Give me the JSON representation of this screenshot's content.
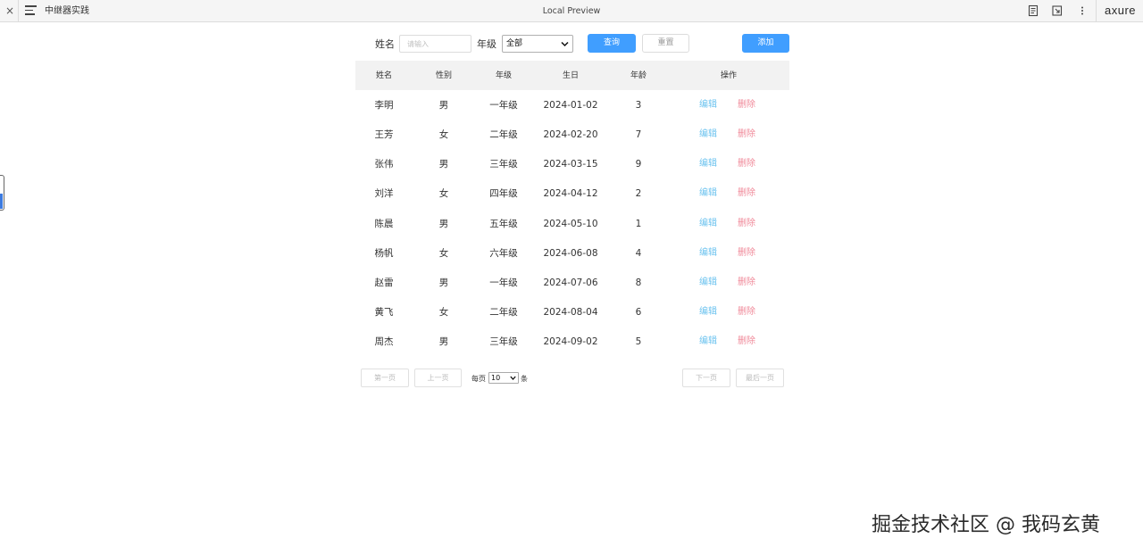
{
  "topbar": {
    "close_glyph": "×",
    "project_name": "中继器实践",
    "title": "Local Preview",
    "logo": "axure",
    "icons": [
      "close-icon",
      "menu-icon",
      "page-notes-icon",
      "open-external-icon",
      "more-vertical-icon"
    ]
  },
  "search": {
    "name_label": "姓名",
    "name_placeholder": "请输入",
    "grade_label": "年级",
    "grade_selected": "全部",
    "query_button": "查询",
    "reset_button": "重置",
    "add_button": "添加"
  },
  "table": {
    "headers": [
      "姓名",
      "性别",
      "年级",
      "生日",
      "年龄",
      "操作"
    ],
    "rows": [
      {
        "name": "李明",
        "gender": "男",
        "grade": "一年级",
        "birthday": "2024-01-02",
        "age": "3",
        "edit": "编辑",
        "delete": "删除"
      },
      {
        "name": "王芳",
        "gender": "女",
        "grade": "二年级",
        "birthday": "2024-02-20",
        "age": "7",
        "edit": "编辑",
        "delete": "删除"
      },
      {
        "name": "张伟",
        "gender": "男",
        "grade": "三年级",
        "birthday": "2024-03-15",
        "age": "9",
        "edit": "编辑",
        "delete": "删除"
      },
      {
        "name": "刘洋",
        "gender": "女",
        "grade": "四年级",
        "birthday": "2024-04-12",
        "age": "2",
        "edit": "编辑",
        "delete": "删除"
      },
      {
        "name": "陈晨",
        "gender": "男",
        "grade": "五年级",
        "birthday": "2024-05-10",
        "age": "1",
        "edit": "编辑",
        "delete": "删除"
      },
      {
        "name": "杨帆",
        "gender": "女",
        "grade": "六年级",
        "birthday": "2024-06-08",
        "age": "4",
        "edit": "编辑",
        "delete": "删除"
      },
      {
        "name": "赵雷",
        "gender": "男",
        "grade": "一年级",
        "birthday": "2024-07-06",
        "age": "8",
        "edit": "编辑",
        "delete": "删除"
      },
      {
        "name": "黄飞",
        "gender": "女",
        "grade": "二年级",
        "birthday": "2024-08-04",
        "age": "6",
        "edit": "编辑",
        "delete": "删除"
      },
      {
        "name": "周杰",
        "gender": "男",
        "grade": "三年级",
        "birthday": "2024-09-02",
        "age": "5",
        "edit": "编辑",
        "delete": "删除"
      }
    ]
  },
  "pagination": {
    "first": "第一页",
    "prev": "上一页",
    "per_page_prefix": "每页",
    "per_page_value": "10",
    "per_page_suffix": "条",
    "next": "下一页",
    "last": "最后一页"
  },
  "watermark": "掘金技术社区 @ 我码玄黄",
  "colors": {
    "primary": "#409eff",
    "edit_link": "#6cc3ef",
    "delete_link": "#f08a9a",
    "header_bg": "#f2f2f2"
  }
}
